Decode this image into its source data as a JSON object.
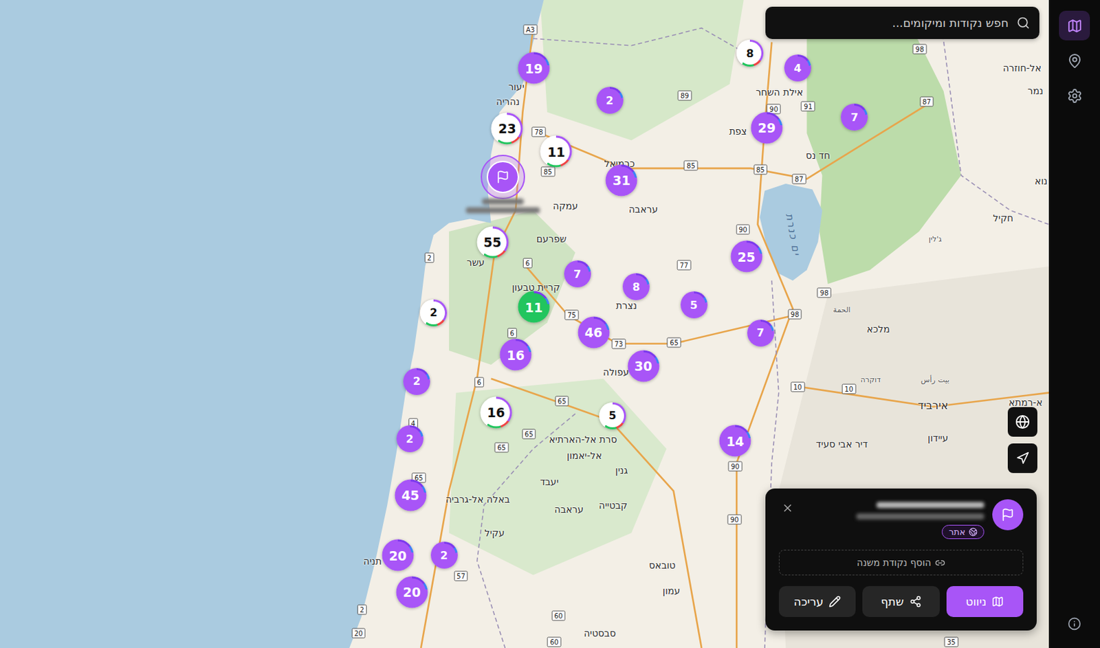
{
  "search": {
    "placeholder": "חפש נקודות ומיקומים..."
  },
  "sidebar": {
    "items": [
      {
        "selected": true
      },
      {
        "selected": false
      },
      {
        "selected": false
      }
    ]
  },
  "clusters": [
    {
      "count": "19",
      "color": "#a855f7"
    },
    {
      "count": "2",
      "color": "#a855f7"
    },
    {
      "count": "8",
      "color": "#ffffff"
    },
    {
      "count": "4",
      "color": "#a855f7"
    },
    {
      "count": "7",
      "color": "#a855f7"
    },
    {
      "count": "29",
      "color": "#a855f7"
    },
    {
      "count": "23",
      "color": "#ffffff"
    },
    {
      "count": "11",
      "color": "#ffffff"
    },
    {
      "count": "31",
      "color": "#a855f7"
    },
    {
      "count": "55",
      "color": "#ffffff"
    },
    {
      "count": "25",
      "color": "#a855f7"
    },
    {
      "count": "7",
      "color": "#a855f7"
    },
    {
      "count": "8",
      "color": "#a855f7"
    },
    {
      "count": "11",
      "color": "#22c55e"
    },
    {
      "count": "5",
      "color": "#a855f7"
    },
    {
      "count": "2",
      "color": "#ffffff"
    },
    {
      "count": "46",
      "color": "#a855f7"
    },
    {
      "count": "7",
      "color": "#a855f7"
    },
    {
      "count": "16",
      "color": "#a855f7"
    },
    {
      "count": "30",
      "color": "#a855f7"
    },
    {
      "count": "2",
      "color": "#a855f7"
    },
    {
      "count": "16",
      "color": "#ffffff"
    },
    {
      "count": "5",
      "color": "#ffffff"
    },
    {
      "count": "2",
      "color": "#a855f7"
    },
    {
      "count": "14",
      "color": "#a855f7"
    },
    {
      "count": "45",
      "color": "#a855f7"
    },
    {
      "count": "20",
      "color": "#a855f7"
    },
    {
      "count": "2",
      "color": "#a855f7"
    },
    {
      "count": "20",
      "color": "#a855f7"
    }
  ],
  "places": [
    {
      "name": "יעור",
      "kind": "town"
    },
    {
      "name": "נהריה",
      "kind": "town"
    },
    {
      "name": "כרמיאל",
      "kind": "town"
    },
    {
      "name": "אילת השחר",
      "kind": "town"
    },
    {
      "name": "צפת",
      "kind": "town"
    },
    {
      "name": "חד נס",
      "kind": "town"
    },
    {
      "name": "עמקה",
      "kind": "town"
    },
    {
      "name": "עראבה",
      "kind": "town"
    },
    {
      "name": "שפרעם",
      "kind": "town"
    },
    {
      "name": "עשר",
      "kind": "town"
    },
    {
      "name": "קריית טבעון",
      "kind": "town"
    },
    {
      "name": "נצרת",
      "kind": "town"
    },
    {
      "name": "עפולה",
      "kind": "town"
    },
    {
      "name": "סרת אל-הארתיא",
      "kind": "town"
    },
    {
      "name": "אל-יאמון",
      "kind": "town"
    },
    {
      "name": "גנין",
      "kind": "town"
    },
    {
      "name": "יעבד",
      "kind": "town"
    },
    {
      "name": "באלה אל-גרביה",
      "kind": "town"
    },
    {
      "name": "עראבה",
      "kind": "town"
    },
    {
      "name": "קבטייה",
      "kind": "town"
    },
    {
      "name": "עקיל",
      "kind": "town"
    },
    {
      "name": "טובאס",
      "kind": "town"
    },
    {
      "name": "עמון",
      "kind": "town"
    },
    {
      "name": "סבסטיה",
      "kind": "town"
    },
    {
      "name": "תניה",
      "kind": "town"
    },
    {
      "name": "מלכא",
      "kind": "town"
    },
    {
      "name": "אל-חוזרה",
      "kind": "town"
    },
    {
      "name": "נמר",
      "kind": "town"
    },
    {
      "name": "חקיל",
      "kind": "town"
    },
    {
      "name": "נוא",
      "kind": "town"
    },
    {
      "name": "ג'לין",
      "kind": "minor"
    },
    {
      "name": "الحمة",
      "kind": "minor"
    },
    {
      "name": "דוקרה",
      "kind": "minor"
    },
    {
      "name": "بيت رأس",
      "kind": "minor"
    },
    {
      "name": "אירביד",
      "kind": "city"
    },
    {
      "name": "דיר אבי סעיד",
      "kind": "town"
    },
    {
      "name": "עיידון",
      "kind": "town"
    },
    {
      "name": "א-רמתא",
      "kind": "town"
    }
  ],
  "roads": [
    {
      "number": "A3"
    },
    {
      "number": "89"
    },
    {
      "number": "90"
    },
    {
      "number": "91"
    },
    {
      "number": "87"
    },
    {
      "number": "98"
    },
    {
      "number": "78"
    },
    {
      "number": "85"
    },
    {
      "number": "85"
    },
    {
      "number": "85"
    },
    {
      "number": "87"
    },
    {
      "number": "90"
    },
    {
      "number": "77"
    },
    {
      "number": "6"
    },
    {
      "number": "2"
    },
    {
      "number": "75"
    },
    {
      "number": "6"
    },
    {
      "number": "73"
    },
    {
      "number": "65"
    },
    {
      "number": "98"
    },
    {
      "number": "98"
    },
    {
      "number": "6"
    },
    {
      "number": "65"
    },
    {
      "number": "4"
    },
    {
      "number": "65"
    },
    {
      "number": "65"
    },
    {
      "number": "90"
    },
    {
      "number": "10"
    },
    {
      "number": "10"
    },
    {
      "number": "65"
    },
    {
      "number": "57"
    },
    {
      "number": "2"
    },
    {
      "number": "20"
    },
    {
      "number": "60"
    },
    {
      "number": "60"
    },
    {
      "number": "90"
    },
    {
      "number": "35"
    }
  ],
  "lake": {
    "name": "ים כנרת"
  },
  "selected_point": {
    "tag": "אתר",
    "add_sub_point": "הוסף נקודת משנה",
    "buttons": [
      {
        "label": "ניווט",
        "kind": "primary"
      },
      {
        "label": "שתף",
        "kind": "secondary"
      },
      {
        "label": "עריכה",
        "kind": "secondary"
      }
    ]
  }
}
